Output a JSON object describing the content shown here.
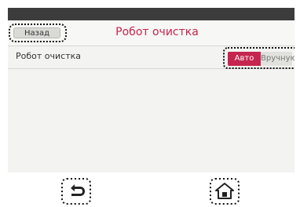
{
  "header": {
    "back_label": "Назад",
    "title": "Робот очистка"
  },
  "setting": {
    "label": "Робот очистка",
    "options": [
      "Авто",
      "Вручную"
    ],
    "selected": "Авто"
  },
  "colors": {
    "accent": "#c5254e",
    "topbar": "#3c3c3c",
    "panel": "#f3f3f1"
  },
  "nav": {
    "back_icon": "back-arrow-icon",
    "home_icon": "home-icon"
  }
}
